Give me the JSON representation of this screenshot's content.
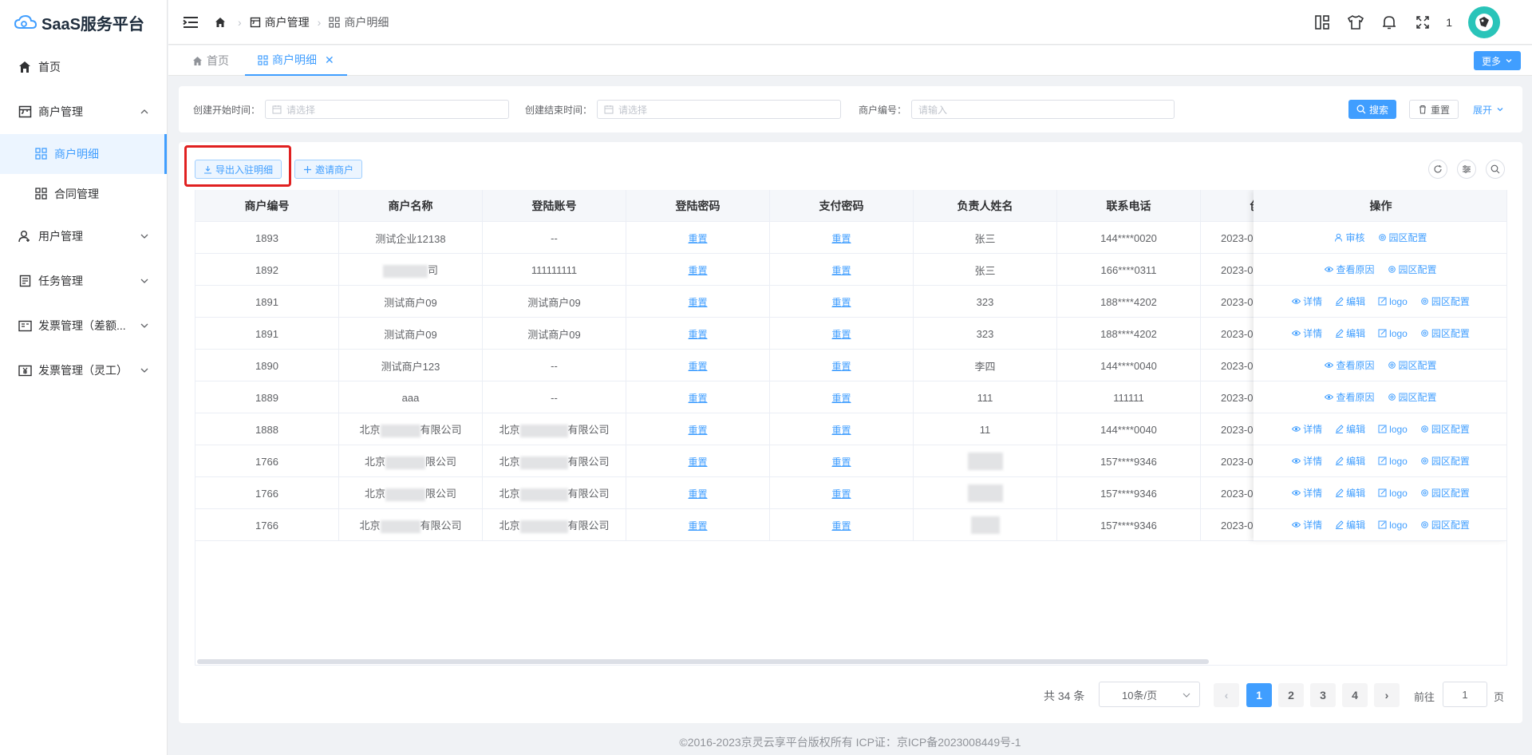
{
  "app": {
    "title": "SaaS服务平台"
  },
  "sidebar": {
    "items": [
      {
        "label": "首页",
        "icon": "home-icon"
      },
      {
        "label": "商户管理",
        "icon": "shop-icon",
        "expanded": true,
        "children": [
          {
            "label": "商户明细",
            "active": true
          },
          {
            "label": "合同管理"
          }
        ]
      },
      {
        "label": "用户管理",
        "icon": "user-icon"
      },
      {
        "label": "任务管理",
        "icon": "task-icon"
      },
      {
        "label": "发票管理（差额...",
        "icon": "invoice-icon"
      },
      {
        "label": "发票管理（灵工）",
        "icon": "yen-icon"
      }
    ]
  },
  "header": {
    "breadcrumb": [
      "商户管理",
      "商户明细"
    ],
    "badge_count": "1"
  },
  "tabs": [
    {
      "label": "首页"
    },
    {
      "label": "商户明细",
      "active": true
    }
  ],
  "more_label": "更多",
  "search": {
    "start_label": "创建开始时间：",
    "start_placeholder": "请选择",
    "end_label": "创建结束时间：",
    "end_placeholder": "请选择",
    "merchant_label": "商户编号：",
    "merchant_placeholder": "请输入",
    "search_btn": "搜索",
    "reset_btn": "重置",
    "expand_btn": "展开"
  },
  "toolbar": {
    "export_btn": "导出入驻明细",
    "invite_btn": "邀请商户"
  },
  "table": {
    "columns": [
      "商户编号",
      "商户名称",
      "登陆账号",
      "登陆密码",
      "支付密码",
      "负责人姓名",
      "联系电话",
      "创建时间",
      "操作"
    ],
    "reset_link": "重置",
    "date_prefix": "2023-0",
    "rows": [
      {
        "id": "1893",
        "name": "测试企业12138",
        "account": "--",
        "person": "张三",
        "phone": "144****0020",
        "ops": [
          "审核",
          "园区配置"
        ]
      },
      {
        "id": "1892",
        "name": "司",
        "account": "111111111",
        "person": "张三",
        "phone": "166****0311",
        "ops": [
          "查看原因",
          "园区配置"
        ]
      },
      {
        "id": "1891",
        "name": "测试商户09",
        "account": "测试商户09",
        "person": "323",
        "phone": "188****4202",
        "ops": [
          "详情",
          "编辑",
          "logo",
          "园区配置"
        ]
      },
      {
        "id": "1891",
        "name": "测试商户09",
        "account": "测试商户09",
        "person": "323",
        "phone": "188****4202",
        "ops": [
          "详情",
          "编辑",
          "logo",
          "园区配置"
        ]
      },
      {
        "id": "1890",
        "name": "测试商户123",
        "account": "--",
        "person": "李四",
        "phone": "144****0040",
        "ops": [
          "查看原因",
          "园区配置"
        ]
      },
      {
        "id": "1889",
        "name": "aaa",
        "account": "--",
        "person": "111",
        "phone": "111111",
        "ops": [
          "查看原因",
          "园区配置"
        ]
      },
      {
        "id": "1888",
        "name": "北京有限公司",
        "account": "北京有限公司",
        "person": "11",
        "phone": "144****0040",
        "ops": [
          "详情",
          "编辑",
          "logo",
          "园区配置"
        ]
      },
      {
        "id": "1766",
        "name": "北京限公司",
        "account": "北京有限公司",
        "person": "",
        "phone": "157****9346",
        "ops": [
          "详情",
          "编辑",
          "logo",
          "园区配置"
        ]
      },
      {
        "id": "1766",
        "name": "北京限公司",
        "account": "北京有限公司",
        "person": "",
        "phone": "157****9346",
        "ops": [
          "详情",
          "编辑",
          "logo",
          "园区配置"
        ]
      },
      {
        "id": "1766",
        "name": "北京有限公司",
        "account": "北京有限公司",
        "person": "",
        "phone": "157****9346",
        "ops": [
          "详情",
          "编辑",
          "logo",
          "园区配置"
        ]
      }
    ]
  },
  "pagination": {
    "total": "共 34 条",
    "page_size": "10条/页",
    "pages": [
      "1",
      "2",
      "3",
      "4"
    ],
    "current": "1",
    "goto_label": "前往",
    "goto_value": "1",
    "unit": "页"
  },
  "footer": "©2016-2023京灵云享平台版权所有 ICP证：京ICP备2023008449号-1",
  "colors": {
    "primary": "#409eff",
    "highlight": "#e02020"
  }
}
